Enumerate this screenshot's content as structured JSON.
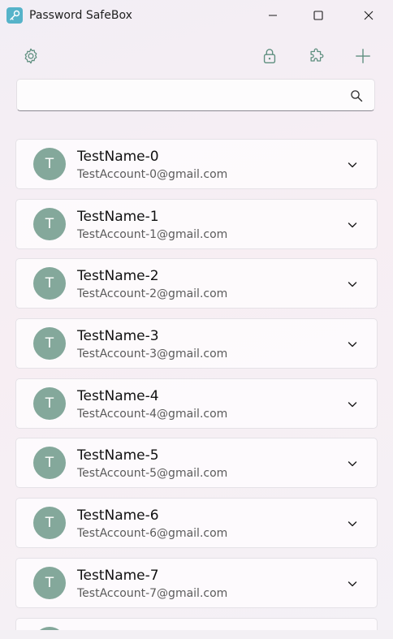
{
  "window": {
    "title": "Password SafeBox"
  },
  "toolbar": {
    "settings_icon": "gear-icon",
    "lock_icon": "lock-icon",
    "plugin_icon": "puzzle-icon",
    "add_icon": "plus-icon"
  },
  "search": {
    "value": "",
    "placeholder": "",
    "icon": "search-icon"
  },
  "accounts": [
    {
      "initial": "T",
      "name": "TestName-0",
      "account": "TestAccount-0@gmail.com"
    },
    {
      "initial": "T",
      "name": "TestName-1",
      "account": "TestAccount-1@gmail.com"
    },
    {
      "initial": "T",
      "name": "TestName-2",
      "account": "TestAccount-2@gmail.com"
    },
    {
      "initial": "T",
      "name": "TestName-3",
      "account": "TestAccount-3@gmail.com"
    },
    {
      "initial": "T",
      "name": "TestName-4",
      "account": "TestAccount-4@gmail.com"
    },
    {
      "initial": "T",
      "name": "TestName-5",
      "account": "TestAccount-5@gmail.com"
    },
    {
      "initial": "T",
      "name": "TestName-6",
      "account": "TestAccount-6@gmail.com"
    },
    {
      "initial": "T",
      "name": "TestName-7",
      "account": "TestAccount-7@gmail.com"
    },
    {
      "initial": "",
      "name": "",
      "account": ""
    }
  ],
  "colors": {
    "accent_icon": "#5e8f7f",
    "avatar_bg": "#84a89b",
    "app_icon_bg": "#56b3c9"
  }
}
